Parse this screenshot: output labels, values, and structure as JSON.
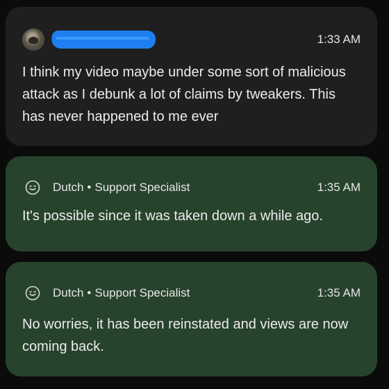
{
  "messages": [
    {
      "sender_type": "user",
      "author_redacted": true,
      "time": "1:33 AM",
      "text": "I think my video maybe under some sort of malicious attack as I debunk a lot of claims by tweakers. This has never happened to me ever"
    },
    {
      "sender_type": "support",
      "author": "Dutch",
      "separator": "•",
      "role": "Support Specialist",
      "time": "1:35 AM",
      "text": "It's possible since it was taken down a while ago."
    },
    {
      "sender_type": "support",
      "author": "Dutch",
      "separator": "•",
      "role": "Support Specialist",
      "time": "1:35 AM",
      "text": "No worries, it has been reinstated and views are now coming back."
    }
  ],
  "colors": {
    "page_background": "#0b0b0b",
    "user_bubble": "#1f1f1f",
    "support_bubble": "#27432c",
    "redaction_blue": "#1e80f0",
    "text": "#ececec"
  },
  "icons": {
    "user_avatar": "user-avatar",
    "support_avatar": "smiley-icon"
  }
}
